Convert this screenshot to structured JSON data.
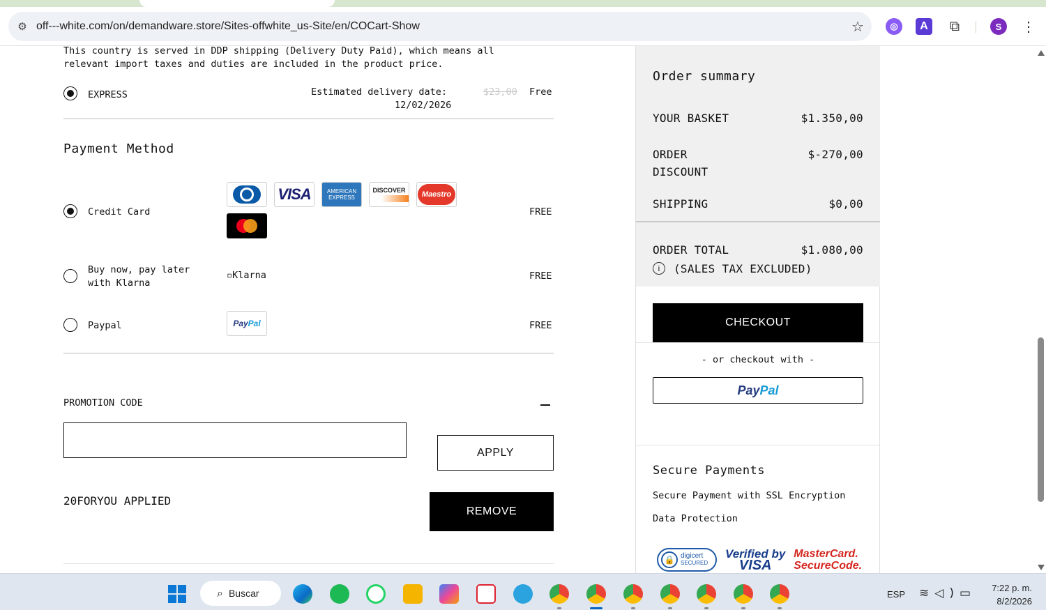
{
  "browser": {
    "url": "off---white.com/on/demandware.store/Sites-offwhite_us-Site/en/COCart-Show",
    "profile_initial": "S",
    "ext2_letter": "A"
  },
  "shipping": {
    "ddp_line1": "This country is served in DDP shipping (Delivery Duty Paid), which means all",
    "ddp_line2": "relevant import taxes and duties are included in the product price.",
    "option_label": "EXPRESS",
    "delivery_label": "Estimated delivery date:",
    "delivery_date": "12/02/2026",
    "old_price": "$23,00",
    "price": "Free"
  },
  "payment": {
    "title": "Payment Method",
    "methods": [
      {
        "label": "Credit Card",
        "fee": "FREE",
        "selected": true
      },
      {
        "label_line1": "Buy now, pay later",
        "label_line2": "with Klarna",
        "image_alt": "Klarna",
        "fee": "FREE",
        "selected": false
      },
      {
        "label": "Paypal",
        "fee": "FREE",
        "selected": false
      }
    ],
    "cards": {
      "visa": "VISA",
      "amex_line1": "AMERICAN",
      "amex_line2": "EXPRESS",
      "discover": "DISCOVER",
      "maestro": "Maestro",
      "paypal_a": "Pay",
      "paypal_b": "Pal"
    }
  },
  "promo": {
    "title": "PROMOTION CODE",
    "input_value": "",
    "apply_label": "APPLY",
    "applied_text": "20FORYOU APPLIED",
    "remove_label": "REMOVE"
  },
  "summary": {
    "title": "Order summary",
    "basket_label": "YOUR BASKET",
    "basket_value": "$1.350,00",
    "discount_label_line1": "ORDER",
    "discount_label_line2": "DISCOUNT",
    "discount_value": "$-270,00",
    "shipping_label": "SHIPPING",
    "shipping_value": "$0,00",
    "total_label": "ORDER TOTAL",
    "total_value": "$1.080,00",
    "tax_note": "(SALES TAX EXCLUDED)",
    "checkout_label": "CHECKOUT",
    "or_checkout": "- or checkout with -",
    "paypal_a": "Pay",
    "paypal_b": "Pal",
    "secure_title": "Secure Payments",
    "secure_line1": "Secure Payment with SSL Encryption",
    "secure_line2": "Data Protection",
    "digicert_line1": "digicert",
    "digicert_line2": "SECURED",
    "vbv_line1": "Verified by",
    "vbv_line2": "VISA",
    "mc_line1": "MasterCard.",
    "mc_line2": "SecureCode."
  },
  "taskbar": {
    "search_label": "Buscar",
    "language": "ESP",
    "time": "7:22 p. m.",
    "date": "8/2/2026"
  },
  "colors": {
    "accent_black": "#000000",
    "summary_bg": "#f1f0f0",
    "paypal_dark": "#253b80",
    "paypal_light": "#179bd7"
  }
}
